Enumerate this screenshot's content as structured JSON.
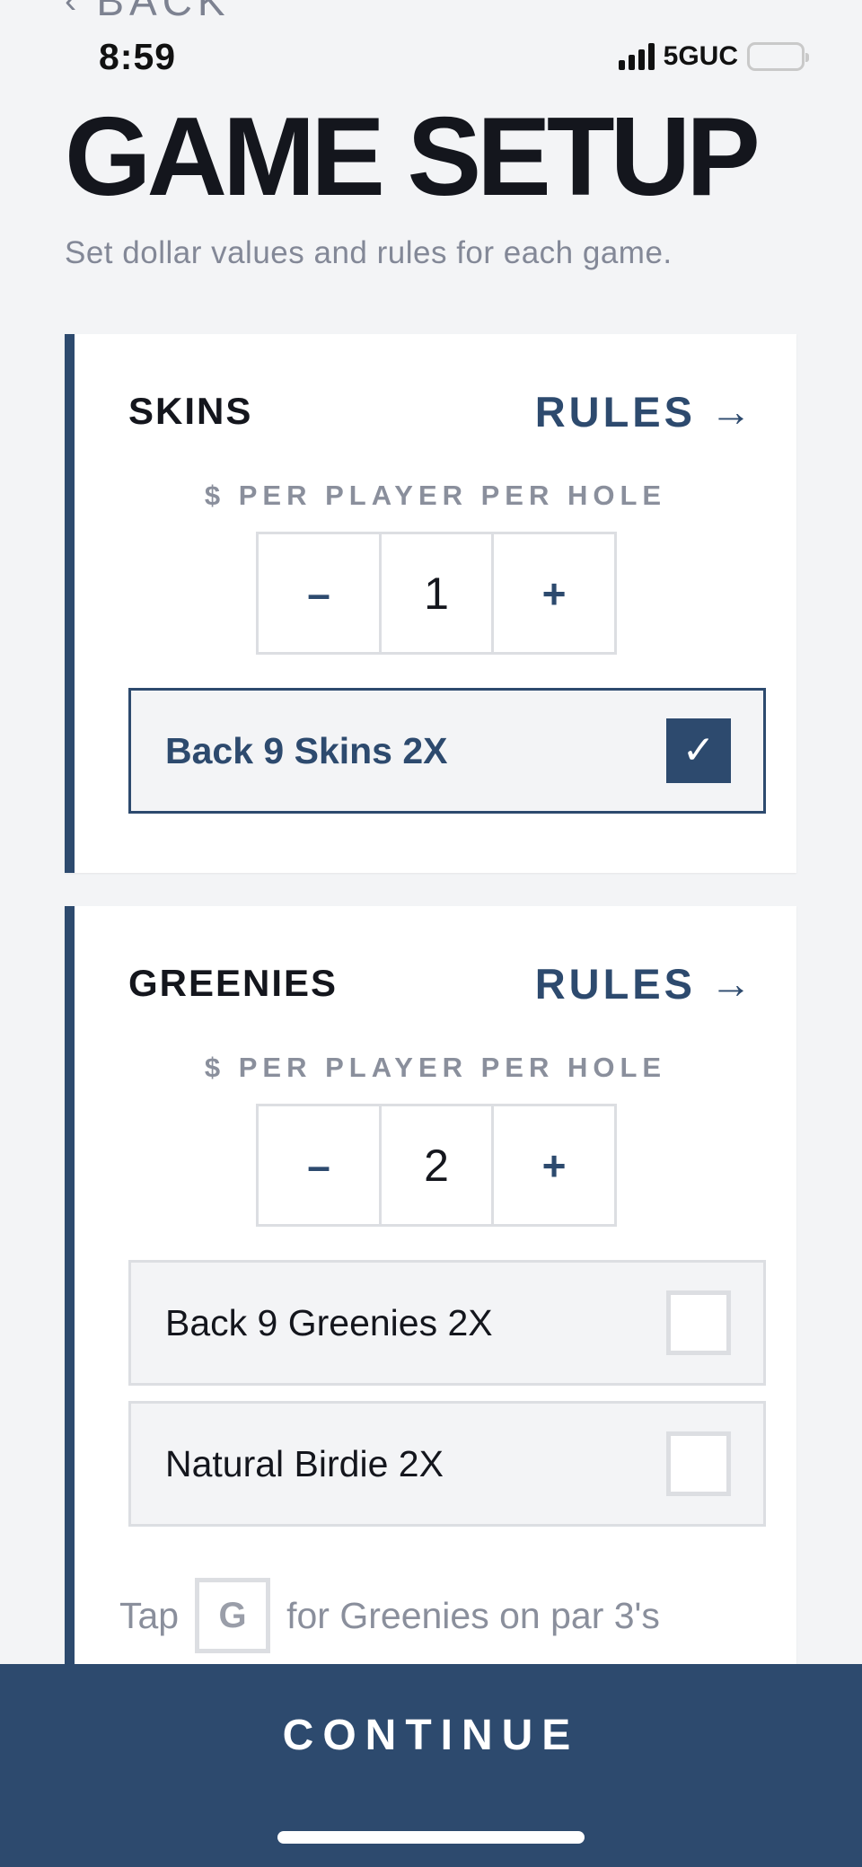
{
  "nav": {
    "back_label": "BACK",
    "back_icon": "chevron-left-icon"
  },
  "status_bar": {
    "time": "8:59",
    "network": "5GUC"
  },
  "header": {
    "title": "GAME SETUP",
    "subtitle": "Set dollar values and rules for each game."
  },
  "colors": {
    "accent": "#2d4a6e",
    "battery": "#f6c608",
    "background": "#f3f4f6"
  },
  "games": [
    {
      "title": "SKINS",
      "rules_label": "RULES",
      "amount_label": "$ PER PLAYER PER HOLE",
      "decrement": "–",
      "amount": "1",
      "increment": "+",
      "options": [
        {
          "label": "Back 9 Skins 2X",
          "checked": true
        }
      ]
    },
    {
      "title": "GREENIES",
      "rules_label": "RULES",
      "amount_label": "$ PER PLAYER PER HOLE",
      "decrement": "–",
      "amount": "2",
      "increment": "+",
      "options": [
        {
          "label": "Back 9 Greenies 2X",
          "checked": false
        },
        {
          "label": "Natural Birdie 2X",
          "checked": false
        }
      ],
      "hint": {
        "prefix": "Tap",
        "key": "G",
        "suffix": "for Greenies on par 3's"
      }
    }
  ],
  "footer": {
    "continue_label": "CONTINUE"
  }
}
